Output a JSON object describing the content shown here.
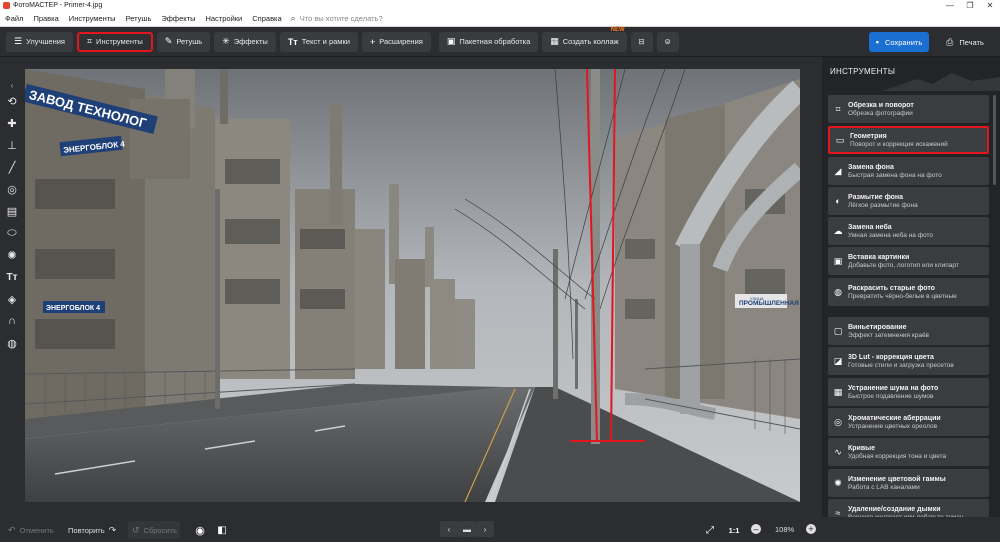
{
  "window": {
    "title": "ФотоМАСТЕР - Primer-4.jpg",
    "minimize": "—",
    "maximize": "❐",
    "close": "✕"
  },
  "menu": {
    "items": [
      "Файл",
      "Правка",
      "Инструменты",
      "Ретушь",
      "Эффекты",
      "Настройки",
      "Справка"
    ],
    "search_placeholder": "Что вы хотите сделать?"
  },
  "toolbar": {
    "tabs": [
      {
        "label": "Улучшения",
        "icon": "sliders-icon"
      },
      {
        "label": "Инструменты",
        "icon": "crop-icon",
        "selected": true
      },
      {
        "label": "Ретушь",
        "icon": "brush-icon"
      },
      {
        "label": "Эффекты",
        "icon": "sparkle-icon"
      },
      {
        "label": "Текст и рамки",
        "icon": "text-icon"
      },
      {
        "label": "Расширения",
        "icon": "plus-icon"
      }
    ],
    "batch_label": "Пакетная обработка",
    "collage_label": "Создать коллаж",
    "collage_badge": "NEW",
    "save_label": "Сохранить",
    "print_label": "Печать"
  },
  "left_tools": [
    "chevron-icon",
    "rotate-icon",
    "patch-icon",
    "stamp-icon",
    "brush-icon",
    "circle-icon",
    "gradient-icon",
    "ellipse-icon",
    "sun-icon",
    "text-icon",
    "fill-icon",
    "magnet-icon",
    "globe-icon"
  ],
  "canvas": {
    "sign_top": "ЗАВОД ТЕХНОЛОГ",
    "sign_block4": "ЭНЕРГОБЛОК 4",
    "sign_block4_lower": "ЭНЕРГОБЛОК 4",
    "sign_street": "ПРОМЫШЛЕННАЯ",
    "sign_street_small": "УЛИЦА"
  },
  "panel": {
    "title": "ИНСТРУМЕНТЫ",
    "items": [
      {
        "name": "Обрезка и поворот",
        "desc": "Обрезка фотографии",
        "icon": "crop-icon"
      },
      {
        "name": "Геометрия",
        "desc": "Поворот и коррекция искажений",
        "icon": "geometry-icon",
        "selected": true
      },
      {
        "name": "Замена фона",
        "desc": "Быстрая замена фона на фото",
        "icon": "background-icon"
      },
      {
        "name": "Размытие фона",
        "desc": "Лёгкое размытие фона",
        "icon": "blur-icon"
      },
      {
        "name": "Замена неба",
        "desc": "Умная замена неба на фото",
        "icon": "cloud-icon"
      },
      {
        "name": "Вставка картинки",
        "desc": "Добавьте фото, логотип или клипарт",
        "icon": "image-insert-icon"
      },
      {
        "name": "Раскрасить старые фото",
        "desc": "Превратить чёрно-белые в цветные",
        "icon": "palette-icon"
      },
      {
        "name": "Виньетирование",
        "desc": "Эффект затемнения краёв",
        "icon": "vignette-icon"
      },
      {
        "name": "3D Lut - коррекция цвета",
        "desc": "Готовые стили и загрузка пресетов",
        "icon": "lut-icon"
      },
      {
        "name": "Устранение шума на фото",
        "desc": "Быстрое подавление шумов",
        "icon": "noise-icon"
      },
      {
        "name": "Хроматические аберрации",
        "desc": "Устранение цветных ореолов",
        "icon": "aberration-icon"
      },
      {
        "name": "Кривые",
        "desc": "Удобная коррекция тона и цвета",
        "icon": "curves-icon"
      },
      {
        "name": "Изменение цветовой гаммы",
        "desc": "Работа с LAB каналами",
        "icon": "hue-icon"
      },
      {
        "name": "Удаление/создание дымки",
        "desc": "Верните контраст или добавьте туман",
        "icon": "haze-icon"
      }
    ]
  },
  "bottom": {
    "undo_label": "Отменить",
    "redo_label": "Повторить",
    "reset_label": "Сбросить",
    "ratio_label": "1:1",
    "zoom_value": "108%"
  },
  "colors": {
    "accent_blue": "#1b6fd3",
    "highlight_red": "#e3151f",
    "new_badge": "#ff7a1a"
  }
}
